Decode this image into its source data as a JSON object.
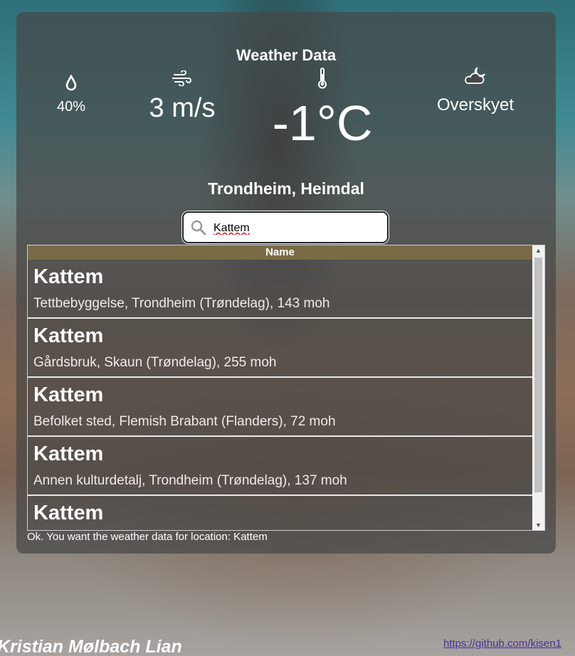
{
  "header": {
    "title": "Weather Data"
  },
  "stats": {
    "humidity": {
      "icon": "water-drop-icon",
      "value": "40%"
    },
    "wind": {
      "icon": "wind-icon",
      "value": "3 m/s"
    },
    "temperature": {
      "icon": "thermometer-icon",
      "value": "-1°C"
    },
    "sky": {
      "icon": "cloudy-moon-icon",
      "value": "Overskyet"
    }
  },
  "location": "Trondheim, Heimdal",
  "search": {
    "value": "Kattem",
    "icon": "search-icon"
  },
  "results": {
    "column_header": "Name",
    "rows": [
      {
        "name": "Kattem",
        "desc": "Tettbebyggelse, Trondheim (Trøndelag), 143 moh"
      },
      {
        "name": "Kattem",
        "desc": "Gårdsbruk, Skaun (Trøndelag), 255 moh"
      },
      {
        "name": "Kattem",
        "desc": "Befolket sted, Flemish Brabant (Flanders), 72 moh"
      },
      {
        "name": "Kattem",
        "desc": "Annen kulturdetalj, Trondheim (Trøndelag), 137 moh"
      },
      {
        "name": "Kattem",
        "desc": ""
      }
    ]
  },
  "status_message": "Ok. You want the weather data for location: Kattem",
  "footer": {
    "author": "Kristian Mølbach Lian",
    "github_link": "https://github.com/kisen1"
  }
}
